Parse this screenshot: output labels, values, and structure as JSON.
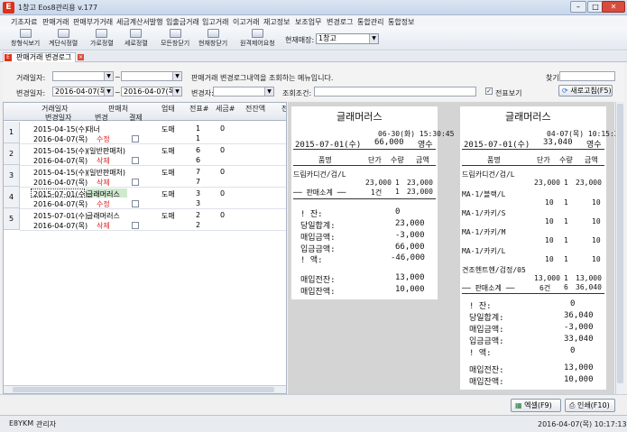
{
  "window": {
    "title": "1창고 Eos8관리용 v.177"
  },
  "menu": [
    "기초자료",
    "판매거래",
    "판매부가거래",
    "세금계산서발행",
    "입출금거래",
    "입고거래",
    "이고거래",
    "재고정보",
    "보조업무",
    "변경로그",
    "통합관리",
    "통합정보"
  ],
  "toolbar": {
    "buttons": [
      "창형식보기",
      "계단식정렬",
      "가로정렬",
      "세로정렬",
      "모든창닫기",
      "현재창닫기",
      "원격제어요청"
    ],
    "store_label": "현재매장:",
    "store_value": "1창고"
  },
  "tab": {
    "label": "판매거래 변경로그"
  },
  "filter": {
    "customer_label": "거래일자:",
    "change_date_label": "변경일자:",
    "date_from": "2016-04-07(목)",
    "date_to": "2016-04-07(목)",
    "tilde": "~",
    "info_text": "판매거래 변경로그내역을 조회하는 메뉴입니다.",
    "changer_label": "변경자:",
    "condition_label": "조회조건:",
    "find_label": "찾기:",
    "slip_view_label": "전표보기",
    "refresh_label": "새로고침(F5)"
  },
  "grid": {
    "headers_top": [
      "거래일자",
      "판매처",
      "업태",
      "전표#",
      "세금#",
      "전잔액",
      "전"
    ],
    "headers_bottom": [
      "변경일자",
      "변경",
      "결제"
    ],
    "rows": [
      {
        "num": "1",
        "a_date": "2015-04-15(수)",
        "a_name": "대너",
        "a_type": "도매",
        "a_slip": "1",
        "a_tax": "0",
        "b_date": "2016-04-07(목)",
        "b_change": "수정",
        "b_slip": "1"
      },
      {
        "num": "2",
        "a_date": "2015-04-15(수)",
        "a_name": "(일반판매처)",
        "a_type": "도매",
        "a_slip": "6",
        "a_tax": "0",
        "b_date": "2016-04-07(목)",
        "b_change": "삭제",
        "b_slip": "6"
      },
      {
        "num": "3",
        "a_date": "2015-04-15(수)",
        "a_name": "(일반판매처)",
        "a_type": "도매",
        "a_slip": "7",
        "a_tax": "0",
        "b_date": "2016-04-07(목)",
        "b_change": "삭제",
        "b_slip": "7"
      },
      {
        "num": "4",
        "a_date": "2015-07-01(수)",
        "a_name": "글래머러스",
        "a_type": "도매",
        "a_slip": "3",
        "a_tax": "0",
        "b_date": "2016-04-07(목)",
        "b_change": "수정",
        "b_slip": "3"
      },
      {
        "num": "5",
        "a_date": "2015-07-01(수)",
        "a_name": "글래머러스",
        "a_type": "도매",
        "a_slip": "2",
        "a_tax": "0",
        "b_date": "2016-04-07(목)",
        "b_change": "삭제",
        "b_slip": "2"
      }
    ]
  },
  "receipt1": {
    "title": "글래머러스",
    "stamp": "06-30(화) 15:30:45",
    "date": "2015-07-01(수)",
    "amount": "66,000",
    "kind": "영수",
    "head": [
      "품명",
      "단가",
      "수량",
      "금액"
    ],
    "item_name": "드림카디건/검/L",
    "item_row": [
      "23,000",
      "1",
      "23,000"
    ],
    "subtotal_label": "── 판매소계 ──",
    "subtotal_row": [
      "1건",
      "1",
      "23,000"
    ],
    "lines": [
      {
        "label": "!      잔:",
        "value": "0"
      },
      {
        "label": "당일합계:",
        "value": "23,000"
      },
      {
        "label": "매입금액:",
        "value": "-3,000"
      },
      {
        "label": "입금금액:",
        "value": "66,000"
      },
      {
        "label": "!      액:",
        "value": "-46,000"
      }
    ],
    "lines2": [
      {
        "label": "매입전잔:",
        "value": "13,000"
      },
      {
        "label": "매입잔액:",
        "value": "10,000"
      }
    ]
  },
  "receipt2": {
    "title": "글래머러스",
    "stamp": "04-07(목) 10:15:23",
    "date": "2015-07-01(수)",
    "amount": "33,040",
    "kind": "영수",
    "head": [
      "품명",
      "단가",
      "수량",
      "금액"
    ],
    "items": [
      {
        "name": "드림카디건/검/L",
        "price": "23,000",
        "qty": "1",
        "total": "23,000"
      },
      {
        "name": "MA-1/블랙/L",
        "price": "10",
        "qty": "1",
        "total": "10"
      },
      {
        "name": "MA-1/카키/S",
        "price": "10",
        "qty": "1",
        "total": "10"
      },
      {
        "name": "MA-1/카키/M",
        "price": "10",
        "qty": "1",
        "total": "10"
      },
      {
        "name": "MA-1/카키/L",
        "price": "10",
        "qty": "1",
        "total": "10"
      },
      {
        "name": "견조헨트헨/검정/05",
        "price": "13,000",
        "qty": "1",
        "total": "13,000"
      }
    ],
    "subtotal_label": "── 판매소계 ──",
    "subtotal_row": [
      "6건",
      "6",
      "36,040"
    ],
    "lines": [
      {
        "label": "!      잔:",
        "value": "0"
      },
      {
        "label": "당일합계:",
        "value": "36,040"
      },
      {
        "label": "매입금액:",
        "value": "-3,000"
      },
      {
        "label": "입금금액:",
        "value": "33,040"
      },
      {
        "label": "!      액:",
        "value": "0"
      }
    ],
    "lines2": [
      {
        "label": "매입전잔:",
        "value": "13,000"
      },
      {
        "label": "매입잔액:",
        "value": "10,000"
      }
    ]
  },
  "buttons": {
    "excel": "엑셀(F9)",
    "print": "인쇄(F10)"
  },
  "status": {
    "user_code": "E8YKM",
    "user_role": "관리자",
    "datetime": "2016-04-07(목) 10:17:13"
  }
}
